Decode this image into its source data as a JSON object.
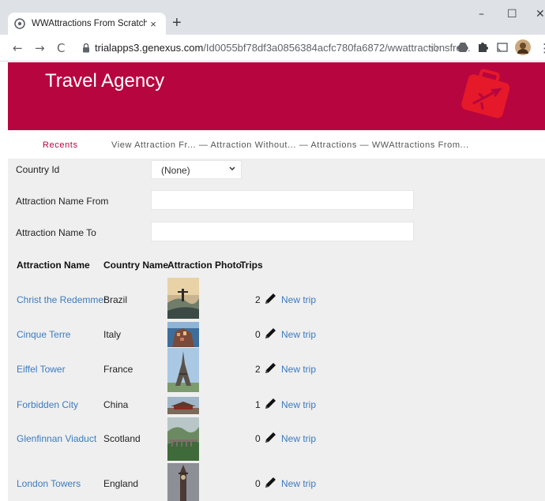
{
  "browser": {
    "tab_title": "WWAttractions From Scratch",
    "tab_close": "×",
    "new_tab": "+",
    "minimize": "–",
    "maximize": "☐",
    "close": "✕",
    "back": "←",
    "forward": "→",
    "reload": "C",
    "url_host": "trialapps3.genexus.com",
    "url_path": "/Id0055bf78df3a0856384acfc780fa6872/wwattractionsfro...",
    "star": "☆"
  },
  "header": {
    "title": "Travel Agency",
    "accent_color": "#b7063f",
    "logo_color": "#e5192a"
  },
  "breadcrumbs": {
    "recents": "Recents",
    "trail": "View Attraction Fr... — Attraction Without... — Attractions — WWAttractions From..."
  },
  "filters": {
    "country_id_label": "Country Id",
    "country_id_value": "(None)",
    "name_from_label": "Attraction Name From",
    "name_from_value": "",
    "name_to_label": "Attraction Name To",
    "name_to_value": ""
  },
  "grid": {
    "columns": [
      "Attraction Name",
      "Country Name",
      "Attraction Photo",
      "Trips"
    ],
    "action_label": "New trip",
    "rows": [
      {
        "name": "Christ the Redemmer",
        "country": "Brazil",
        "trips": "2",
        "photo": "christ-redeemer-photo"
      },
      {
        "name": "Cinque Terre",
        "country": "Italy",
        "trips": "0",
        "photo": "cinque-terre-photo"
      },
      {
        "name": "Eiffel Tower",
        "country": "France",
        "trips": "2",
        "photo": "eiffel-tower-photo"
      },
      {
        "name": "Forbidden City",
        "country": "China",
        "trips": "1",
        "photo": "forbidden-city-photo"
      },
      {
        "name": "Glenfinnan Viaduct",
        "country": "Scotland",
        "trips": "0",
        "photo": "glenfinnan-viaduct-photo"
      },
      {
        "name": "London Towers",
        "country": "England",
        "trips": "0",
        "photo": "big-ben-photo"
      }
    ]
  }
}
